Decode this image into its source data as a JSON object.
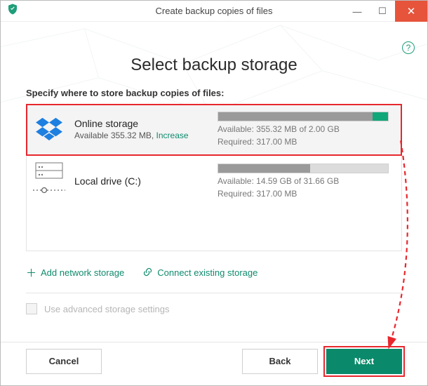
{
  "window": {
    "title": "Create backup copies of files"
  },
  "page": {
    "heading": "Select backup storage",
    "prompt": "Specify where to store backup copies of files:"
  },
  "help_glyph": "?",
  "storages": {
    "online": {
      "name": "Online storage",
      "sub_prefix": "Available 355.32 MB,",
      "sub_link": "Increase",
      "available_line": "Available: 355.32 MB of 2.00 GB",
      "required_line": "Required: 317.00 MB",
      "bar_fill_pct": 91,
      "bar_tip_pct": 9
    },
    "local": {
      "name": "Local drive (C:)",
      "available_line": "Available: 14.59 GB of 31.66 GB",
      "required_line": "Required: 317.00 MB",
      "bar_fill_pct": 54
    }
  },
  "actions": {
    "add_network": "Add network storage",
    "connect_existing": "Connect existing storage"
  },
  "advanced": {
    "label": "Use advanced storage settings"
  },
  "buttons": {
    "cancel": "Cancel",
    "back": "Back",
    "next": "Next"
  },
  "titlebar": {
    "min": "—",
    "max": "☐",
    "close": "✕"
  }
}
